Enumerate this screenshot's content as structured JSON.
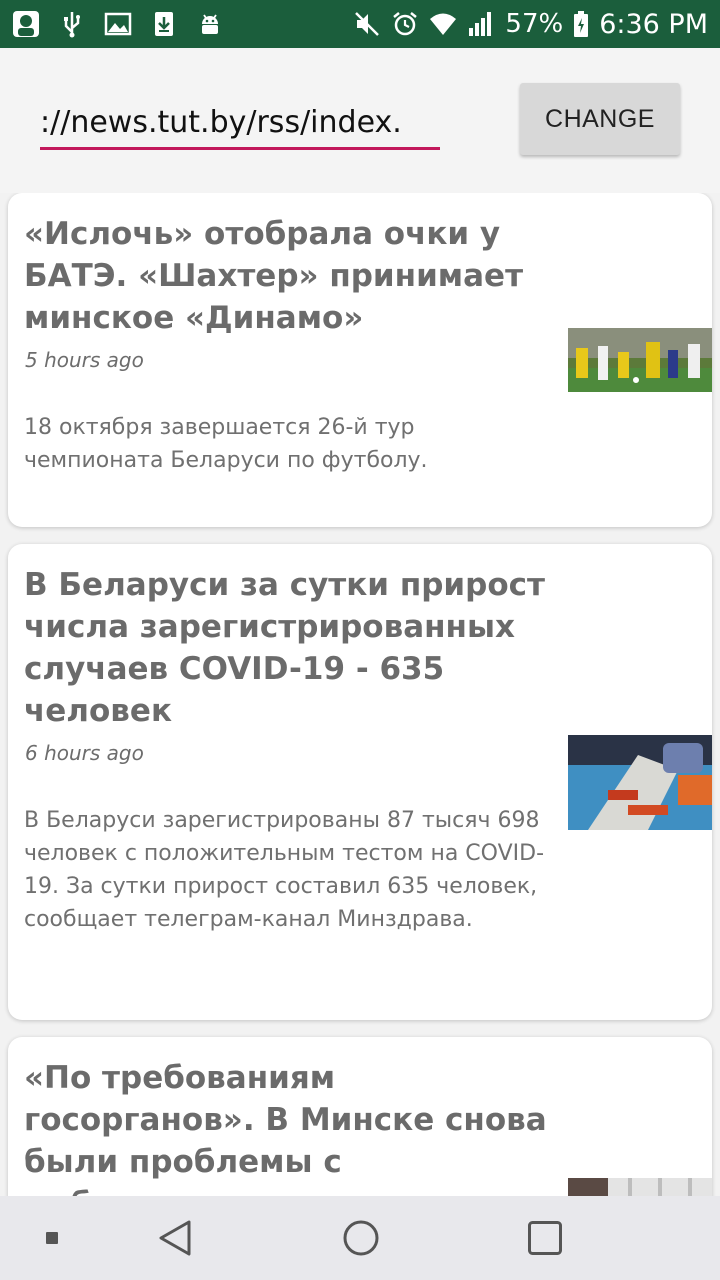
{
  "status_bar": {
    "battery_percent": "57%",
    "time": "6:36 PM",
    "left_icons": [
      "app-avatar-icon",
      "usb-icon",
      "image-icon",
      "download-icon",
      "android-icon"
    ],
    "right_icons": [
      "mute-icon",
      "alarm-icon",
      "wifi-icon",
      "signal-icon",
      "battery-icon"
    ],
    "background_color": "#1b5e3c"
  },
  "toolbar": {
    "url_value": "://news.tut.by/rss/index.",
    "change_label": "CHANGE",
    "accent_color": "#c2185b"
  },
  "feed": {
    "items": [
      {
        "title": "«Ислочь» отобрала очки у БАТЭ. «Шахтер» принимает минское «Динамо»",
        "time": "5 hours ago",
        "description": "18 октября завершается 26-й тур чемпионата Беларуси по футболу.",
        "image": "football-match-thumbnail"
      },
      {
        "title": "В Беларуси за сутки прирост числа зарегистрированных случаев COVID-19 - 635 человек",
        "time": "6 hours ago",
        "description": "В Беларуси зарегистрированы 87 тысяч 698 человек с положительным тестом на COVID-19. За сутки прирост составил 635 человек, сообщает телеграм-канал Минздрава.",
        "image": "covid-test-thumbnail"
      },
      {
        "title": "«По требованиям госорганов». В Минске снова были проблемы с мобильным",
        "time": "",
        "description": "",
        "image": "third-news-thumbnail"
      }
    ]
  },
  "nav_bar": {
    "icons": [
      "recent-dot-icon",
      "back-icon",
      "home-icon",
      "overview-icon"
    ]
  }
}
